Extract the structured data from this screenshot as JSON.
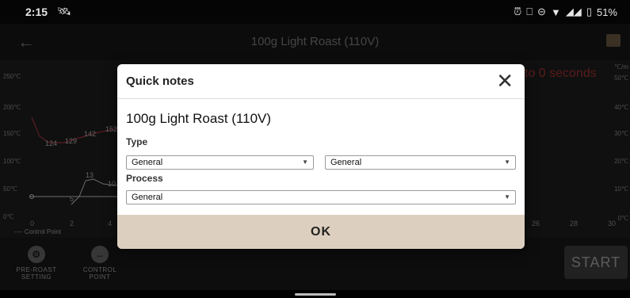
{
  "status_bar": {
    "time": "2:15",
    "battery": "51%"
  },
  "app_bar": {
    "title": "100g Light Roast (110V)"
  },
  "chart": {
    "countdown": "to 0 seconds",
    "y_left_ticks": [
      "250℃",
      "200℃",
      "150℃",
      "100℃",
      "50℃",
      "0℃"
    ],
    "y_right_ticks": [
      "50℃",
      "40℃",
      "30℃",
      "20℃",
      "10℃",
      "0℃"
    ],
    "y_right_unit": "℃/m",
    "x_ticks_left": [
      "0",
      "2",
      "4"
    ],
    "x_ticks_right": [
      "26",
      "28",
      "30"
    ],
    "legend": "---- Control Point",
    "point_labels": [
      "124",
      "129",
      "142",
      "152",
      "13",
      "5",
      "10"
    ]
  },
  "bottom_panel": {
    "pre_roast_label_1": "PRE-ROAST",
    "pre_roast_label_2": "SETTING",
    "control_point_label_1": "CONTROL",
    "control_point_label_2": "POINT",
    "start_label": "START"
  },
  "dialog": {
    "title": "Quick notes",
    "roast_name": "100g Light Roast (110V)",
    "type_label": "Type",
    "type_select_1": "General",
    "type_select_2": "General",
    "process_label": "Process",
    "process_select": "General",
    "ok_label": "OK"
  },
  "colors": {
    "accent_curve": "#8a2a3a",
    "dialog_ok_bg": "#dccfbf"
  }
}
